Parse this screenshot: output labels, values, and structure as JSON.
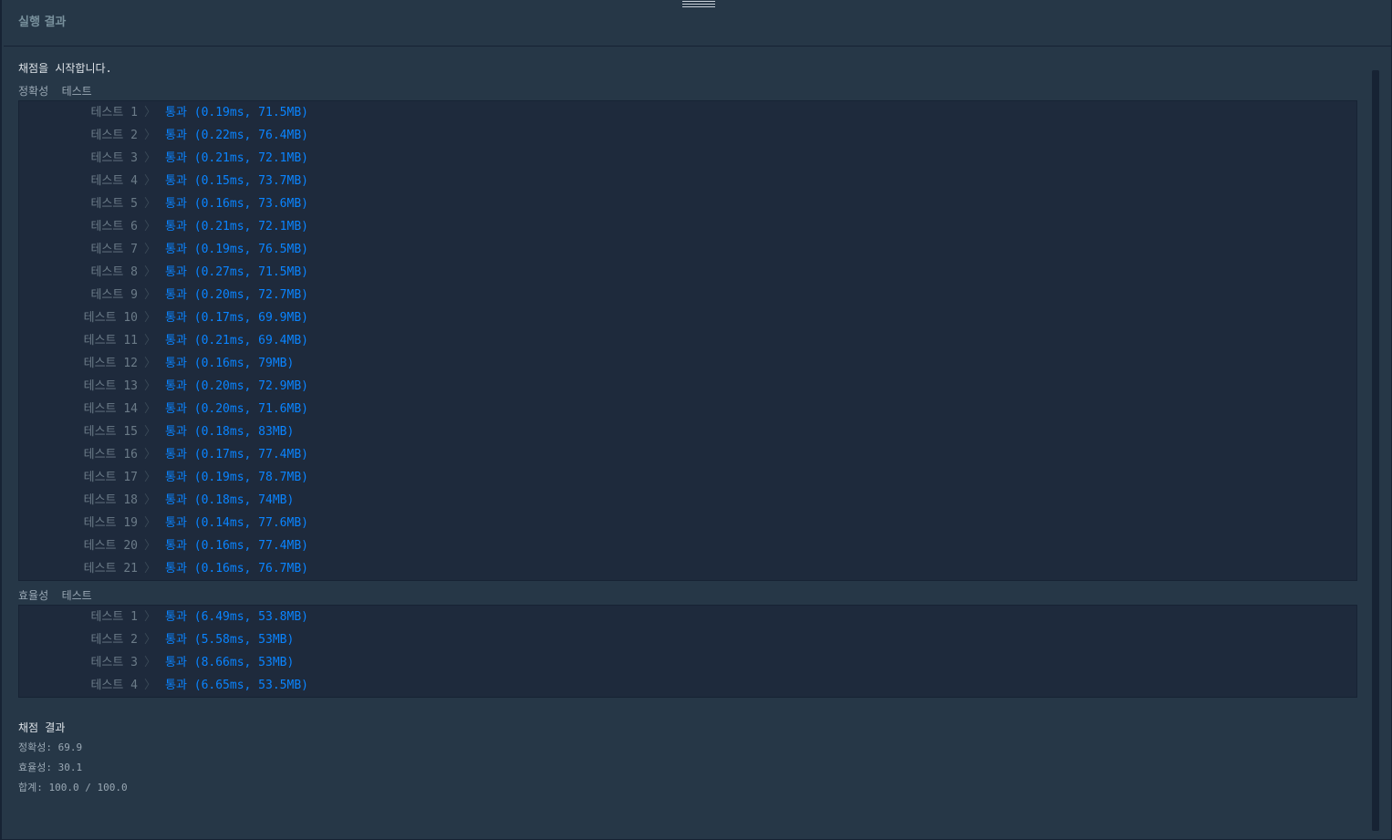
{
  "header": {
    "title": "실행 결과"
  },
  "start_message": "채점을 시작합니다.",
  "correctness": {
    "title": "정확성  테스트",
    "tests": [
      {
        "label": "테스트 1",
        "result": "통과 (0.19ms, 71.5MB)"
      },
      {
        "label": "테스트 2",
        "result": "통과 (0.22ms, 76.4MB)"
      },
      {
        "label": "테스트 3",
        "result": "통과 (0.21ms, 72.1MB)"
      },
      {
        "label": "테스트 4",
        "result": "통과 (0.15ms, 73.7MB)"
      },
      {
        "label": "테스트 5",
        "result": "통과 (0.16ms, 73.6MB)"
      },
      {
        "label": "테스트 6",
        "result": "통과 (0.21ms, 72.1MB)"
      },
      {
        "label": "테스트 7",
        "result": "통과 (0.19ms, 76.5MB)"
      },
      {
        "label": "테스트 8",
        "result": "통과 (0.27ms, 71.5MB)"
      },
      {
        "label": "테스트 9",
        "result": "통과 (0.20ms, 72.7MB)"
      },
      {
        "label": "테스트 10",
        "result": "통과 (0.17ms, 69.9MB)"
      },
      {
        "label": "테스트 11",
        "result": "통과 (0.21ms, 69.4MB)"
      },
      {
        "label": "테스트 12",
        "result": "통과 (0.16ms, 79MB)"
      },
      {
        "label": "테스트 13",
        "result": "통과 (0.20ms, 72.9MB)"
      },
      {
        "label": "테스트 14",
        "result": "통과 (0.20ms, 71.6MB)"
      },
      {
        "label": "테스트 15",
        "result": "통과 (0.18ms, 83MB)"
      },
      {
        "label": "테스트 16",
        "result": "통과 (0.17ms, 77.4MB)"
      },
      {
        "label": "테스트 17",
        "result": "통과 (0.19ms, 78.7MB)"
      },
      {
        "label": "테스트 18",
        "result": "통과 (0.18ms, 74MB)"
      },
      {
        "label": "테스트 19",
        "result": "통과 (0.14ms, 77.6MB)"
      },
      {
        "label": "테스트 20",
        "result": "통과 (0.16ms, 77.4MB)"
      },
      {
        "label": "테스트 21",
        "result": "통과 (0.16ms, 76.7MB)"
      }
    ]
  },
  "efficiency": {
    "title": "효율성  테스트",
    "tests": [
      {
        "label": "테스트 1",
        "result": "통과 (6.49ms, 53.8MB)"
      },
      {
        "label": "테스트 2",
        "result": "통과 (5.58ms, 53MB)"
      },
      {
        "label": "테스트 3",
        "result": "통과 (8.66ms, 53MB)"
      },
      {
        "label": "테스트 4",
        "result": "통과 (6.65ms, 53.5MB)"
      }
    ]
  },
  "separator_glyph": "〉",
  "summary": {
    "title": "채점 결과",
    "correctness": "정확성: 69.9",
    "efficiency": "효율성: 30.1",
    "total": "합계: 100.0 / 100.0"
  },
  "colors": {
    "background": "#263747",
    "pass": "#0a84ff",
    "label": "#6b7b88"
  }
}
